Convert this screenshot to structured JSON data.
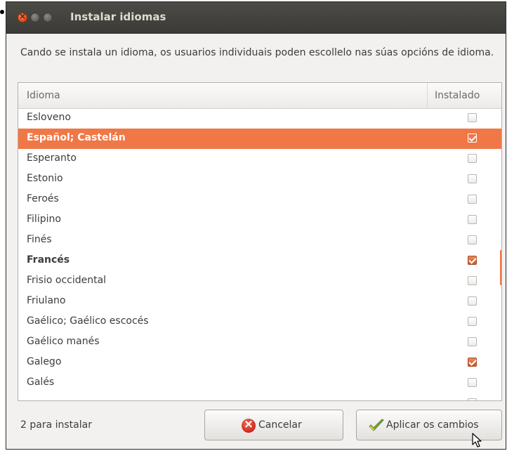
{
  "window": {
    "title": "Instalar idiomas"
  },
  "description": "Cando se instala un idioma, os usuarios individuais poden escollelo nas súas opcións de idioma.",
  "list": {
    "columns": [
      "Idioma",
      "Instalado"
    ],
    "rows": [
      {
        "name": "Esloveno",
        "installed": false,
        "selected": false,
        "bold": false
      },
      {
        "name": "Español; Castelán",
        "installed": true,
        "selected": true,
        "bold": true
      },
      {
        "name": "Esperanto",
        "installed": false,
        "selected": false,
        "bold": false
      },
      {
        "name": "Estonio",
        "installed": false,
        "selected": false,
        "bold": false
      },
      {
        "name": "Feroés",
        "installed": false,
        "selected": false,
        "bold": false
      },
      {
        "name": "Filipino",
        "installed": false,
        "selected": false,
        "bold": false
      },
      {
        "name": "Finés",
        "installed": false,
        "selected": false,
        "bold": false
      },
      {
        "name": "Francés",
        "installed": true,
        "selected": false,
        "bold": true
      },
      {
        "name": "Frisio occidental",
        "installed": false,
        "selected": false,
        "bold": false
      },
      {
        "name": "Friulano",
        "installed": false,
        "selected": false,
        "bold": false
      },
      {
        "name": "Gaélico; Gaélico escocés",
        "installed": false,
        "selected": false,
        "bold": false
      },
      {
        "name": "Gaélico manés",
        "installed": false,
        "selected": false,
        "bold": false
      },
      {
        "name": "Galego",
        "installed": true,
        "selected": false,
        "bold": false
      },
      {
        "name": "Galés",
        "installed": false,
        "selected": false,
        "bold": false
      },
      {
        "name": "",
        "installed": false,
        "selected": false,
        "bold": false
      }
    ]
  },
  "status": "2 para instalar",
  "buttons": {
    "cancel": "Cancelar",
    "apply": "Aplicar os cambios"
  },
  "colors": {
    "accent": "#f07746",
    "titlebar": "#3c3b37",
    "window_bg": "#f2f1f0"
  },
  "icons": {
    "cancel": "cancel-icon",
    "apply": "checkmark-icon"
  }
}
